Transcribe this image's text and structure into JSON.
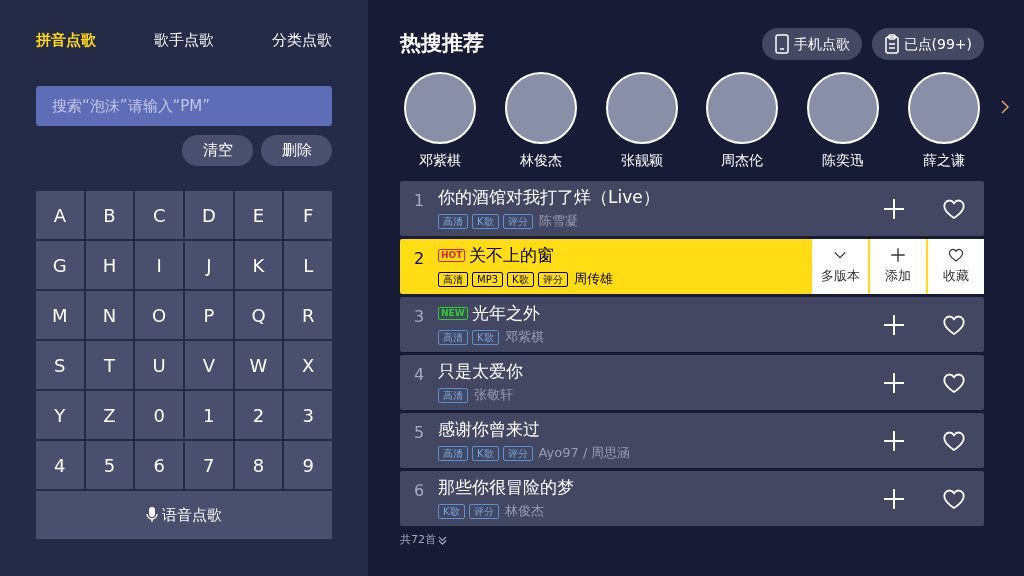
{
  "tabs": [
    {
      "label": "拼音点歌",
      "selected": true
    },
    {
      "label": "歌手点歌",
      "selected": false
    },
    {
      "label": "分类点歌",
      "selected": false
    }
  ],
  "search": {
    "placeholder": "搜索“泡沫”请输入“PM”"
  },
  "search_buttons": [
    "清空",
    "删除"
  ],
  "keys": [
    "A",
    "B",
    "C",
    "D",
    "E",
    "F",
    "G",
    "H",
    "I",
    "J",
    "K",
    "L",
    "M",
    "N",
    "O",
    "P",
    "Q",
    "R",
    "S",
    "T",
    "U",
    "V",
    "W",
    "X",
    "Y",
    "Z",
    "0",
    "1",
    "2",
    "3",
    "4",
    "5",
    "6",
    "7",
    "8",
    "9"
  ],
  "voice_button": "语音点歌",
  "title": "热搜推荐",
  "header_buttons": [
    {
      "kind": "phone",
      "label": "手机点歌"
    },
    {
      "kind": "list",
      "label": "已点(99+)"
    }
  ],
  "artists": [
    {
      "name": "邓紫棋"
    },
    {
      "name": "林俊杰"
    },
    {
      "name": "张靓颖"
    },
    {
      "name": "周杰伦"
    },
    {
      "name": "陈奕迅"
    },
    {
      "name": "薛之谦"
    }
  ],
  "songs": [
    {
      "number": "1",
      "title": "你的酒馆对我打了烊（Live）",
      "tags": [
        "高清",
        "K歌",
        "评分"
      ],
      "artist": "陈雪凝",
      "selected": false
    },
    {
      "number": "2",
      "badge": {
        "kind": "hot",
        "label": "HOT"
      },
      "title": "关不上的窗",
      "tags": [
        "高清",
        "MP3",
        "K歌",
        "评分"
      ],
      "artist": "周传雄",
      "selected": true
    },
    {
      "number": "3",
      "badge": {
        "kind": "new",
        "label": "NEW"
      },
      "title": "光年之外",
      "tags": [
        "高清",
        "K歌"
      ],
      "artist": "邓紫棋",
      "selected": false
    },
    {
      "number": "4",
      "title": "只是太爱你",
      "tags": [
        "高清"
      ],
      "artist": "张敬轩",
      "selected": false
    },
    {
      "number": "5",
      "title": "感谢你曾来过",
      "tags": [
        "高清",
        "K歌",
        "评分"
      ],
      "artist": "Ayo97 / 周思涵",
      "selected": false
    },
    {
      "number": "6",
      "title": "那些你很冒险的梦",
      "tags": [
        "K歌",
        "评分"
      ],
      "artist": "林俊杰",
      "selected": false
    }
  ],
  "selected_actions": [
    {
      "kind": "versions",
      "label": "多版本"
    },
    {
      "kind": "add",
      "label": "添加"
    },
    {
      "kind": "favorite",
      "label": "收藏"
    }
  ],
  "footer": "共72首"
}
